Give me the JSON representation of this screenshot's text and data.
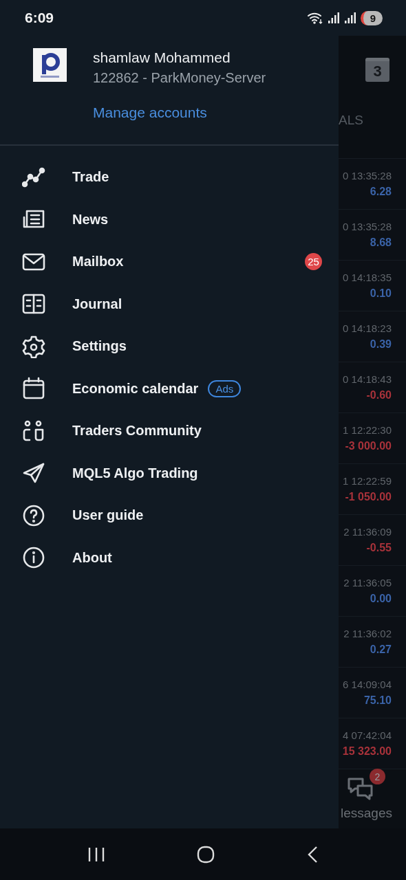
{
  "status_bar": {
    "time": "6:09",
    "battery": "9"
  },
  "account": {
    "name": "shamlaw Mohammed",
    "server": "122862 - ParkMoney-Server",
    "manage_link": "Manage accounts"
  },
  "menu": [
    {
      "label": "Trade",
      "kind": "trade"
    },
    {
      "label": "News",
      "kind": "news"
    },
    {
      "label": "Mailbox",
      "kind": "mail",
      "badge": "25"
    },
    {
      "label": "Journal",
      "kind": "journal"
    },
    {
      "label": "Settings",
      "kind": "settings"
    },
    {
      "label": "Economic calendar",
      "kind": "calendar",
      "tag": "Ads"
    },
    {
      "label": "Traders Community",
      "kind": "community"
    },
    {
      "label": "MQL5 Algo Trading",
      "kind": "send"
    },
    {
      "label": "User guide",
      "kind": "help"
    },
    {
      "label": "About",
      "kind": "info"
    }
  ],
  "background": {
    "calendar_day": "3",
    "header": "ALS",
    "deals": [
      {
        "time": "0 13:35:28",
        "profit": "6.28",
        "color": "#3a63a8"
      },
      {
        "time": "0 13:35:28",
        "profit": "8.68",
        "color": "#3a63a8"
      },
      {
        "time": "0 14:18:35",
        "profit": "0.10",
        "color": "#3a63a8"
      },
      {
        "time": "0 14:18:23",
        "profit": "0.39",
        "color": "#3a63a8"
      },
      {
        "time": "0 14:18:43",
        "profit": "-0.60",
        "color": "#a8323a"
      },
      {
        "time": "1 12:22:30",
        "profit": "-3 000.00",
        "color": "#a8323a"
      },
      {
        "time": "1 12:22:59",
        "profit": "-1 050.00",
        "color": "#a8323a"
      },
      {
        "time": "2 11:36:09",
        "profit": "-0.55",
        "color": "#a8323a"
      },
      {
        "time": "2 11:36:05",
        "profit": "0.00",
        "color": "#3a63a8"
      },
      {
        "time": "2 11:36:02",
        "profit": "0.27",
        "color": "#3a63a8"
      },
      {
        "time": "6 14:09:04",
        "profit": "75.10",
        "color": "#3a63a8"
      },
      {
        "time": "4 07:42:04",
        "profit": "15 323.00",
        "color": "#a8323a"
      }
    ],
    "messages": {
      "label": "lessages",
      "badge": "2"
    }
  }
}
